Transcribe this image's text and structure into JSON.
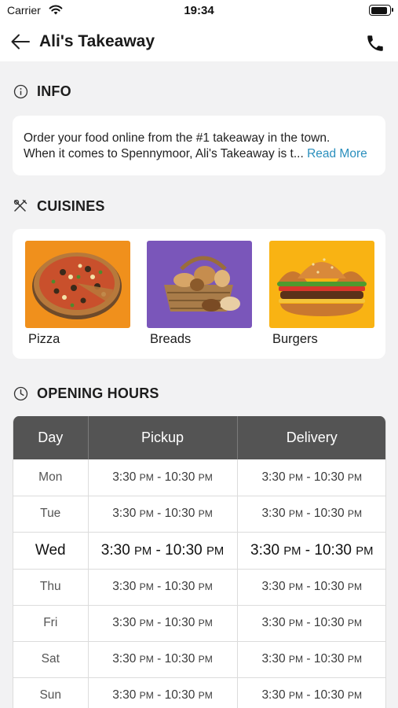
{
  "status_bar": {
    "carrier": "Carrier",
    "time": "19:34",
    "battery_level": 0.9
  },
  "nav": {
    "title": "Ali's Takeaway",
    "back_icon": "arrow-left-icon",
    "call_icon": "phone-icon"
  },
  "info": {
    "heading": "INFO",
    "icon": "info-circle-icon",
    "line1": "Order your food online from the #1 takeaway in the town.",
    "line2": "When it comes to Spennymoor, Ali's Takeaway is t...",
    "read_more": "Read More"
  },
  "cuisines": {
    "heading": "CUISINES",
    "icon": "utensils-icon",
    "items": [
      {
        "name": "Pizza",
        "bg": "#f0901c"
      },
      {
        "name": "Breads",
        "bg": "#7a56ba"
      },
      {
        "name": "Burgers",
        "bg": "#f9b313"
      }
    ]
  },
  "opening_hours": {
    "heading": "OPENING HOURS",
    "icon": "clock-icon",
    "columns": [
      "Day",
      "Pickup",
      "Delivery"
    ],
    "rows": [
      {
        "day": "Mon",
        "pickup": "3:30 PM - 10:30 PM",
        "delivery": "3:30 PM - 10:30 PM"
      },
      {
        "day": "Tue",
        "pickup": "3:30 PM - 10:30 PM",
        "delivery": "3:30 PM - 10:30 PM"
      },
      {
        "day": "Wed",
        "pickup": "3:30 PM - 10:30 PM",
        "delivery": "3:30 PM - 10:30 PM"
      },
      {
        "day": "Thu",
        "pickup": "3:30 PM - 10:30 PM",
        "delivery": "3:30 PM - 10:30 PM"
      },
      {
        "day": "Fri",
        "pickup": "3:30 PM - 10:30 PM",
        "delivery": "3:30 PM - 10:30 PM"
      },
      {
        "day": "Sat",
        "pickup": "3:30 PM - 10:30 PM",
        "delivery": "3:30 PM - 10:30 PM"
      },
      {
        "day": "Sun",
        "pickup": "3:30 PM - 10:30 PM",
        "delivery": "3:30 PM - 10:30 PM"
      }
    ],
    "highlighted_day": "Wed"
  }
}
